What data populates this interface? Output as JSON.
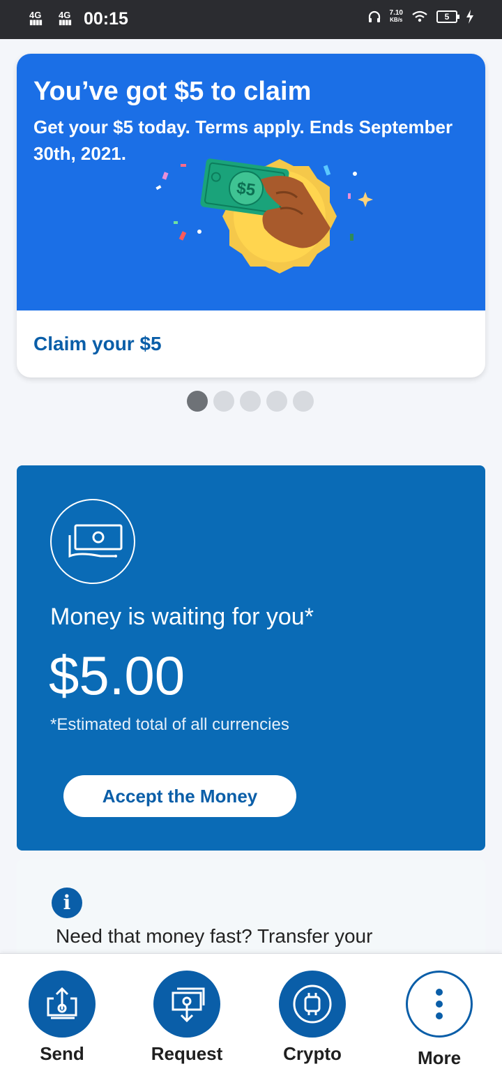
{
  "status_bar": {
    "net1": "4G",
    "net2": "4G",
    "time": "00:15",
    "speed_value": "7.10",
    "speed_unit": "KB/s",
    "battery": "5"
  },
  "promo": {
    "title": "You’ve got $5 to claim",
    "subtitle": "Get your $5 today. Terms apply. Ends September 30th, 2021.",
    "bill_label": "$5",
    "link_label": "Claim your $5"
  },
  "carousel": {
    "count": 5,
    "active_index": 0
  },
  "money_card": {
    "headline": "Money is waiting for you*",
    "amount": "$5.00",
    "note": "*Estimated total of all currencies",
    "button_label": "Accept the Money"
  },
  "info_card": {
    "icon": "i",
    "text": "Need that money fast? Transfer your"
  },
  "bottom_nav": {
    "send": "Send",
    "request": "Request",
    "crypto": "Crypto",
    "more": "More"
  },
  "colors": {
    "promo_blue": "#1b6fe6",
    "card_blue": "#0a6bb6",
    "brand_blue": "#0a5ea8"
  }
}
